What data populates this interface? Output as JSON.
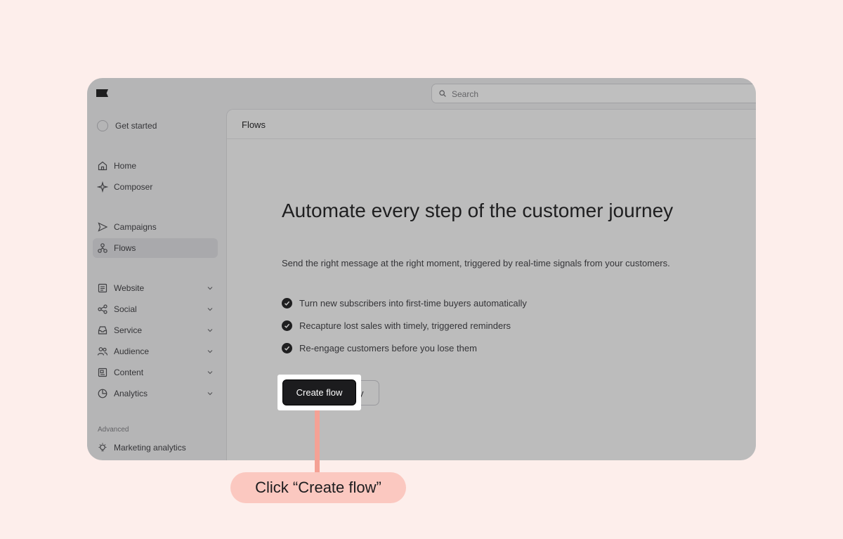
{
  "search": {
    "placeholder": "Search"
  },
  "sidebar": {
    "get_started": "Get started",
    "items": [
      {
        "label": "Home",
        "icon": "home-icon"
      },
      {
        "label": "Composer",
        "icon": "sparkle-icon"
      },
      {
        "label": "Campaigns",
        "icon": "send-icon"
      },
      {
        "label": "Flows",
        "icon": "flows-icon",
        "active": true
      },
      {
        "label": "Website",
        "icon": "website-icon"
      },
      {
        "label": "Social",
        "icon": "share-icon"
      },
      {
        "label": "Service",
        "icon": "inbox-icon"
      },
      {
        "label": "Audience",
        "icon": "users-icon"
      },
      {
        "label": "Content",
        "icon": "content-icon"
      },
      {
        "label": "Analytics",
        "icon": "pie-chart-icon"
      }
    ],
    "advanced_label": "Advanced",
    "advanced_items": [
      {
        "label": "Marketing analytics",
        "icon": "bulb-icon"
      }
    ]
  },
  "main": {
    "title": "Flows",
    "headline": "Automate every step of the customer journey",
    "subtext": "Send the right message at the right moment, triggered by real-time signals from your customers.",
    "bullets": [
      "Turn new subscribers into first-time buyers automatically",
      "Recapture lost sales with timely, triggered reminders",
      "Re-engage customers before you lose them"
    ],
    "primary_button": "Create flow",
    "secondary_button": "View Flow library"
  },
  "callout": {
    "text": "Click “Create flow”"
  },
  "colors": {
    "background": "#fdeeeb",
    "callout": "#fbc8c0",
    "connector": "#f4a195",
    "primary": "#1c1c1e"
  }
}
